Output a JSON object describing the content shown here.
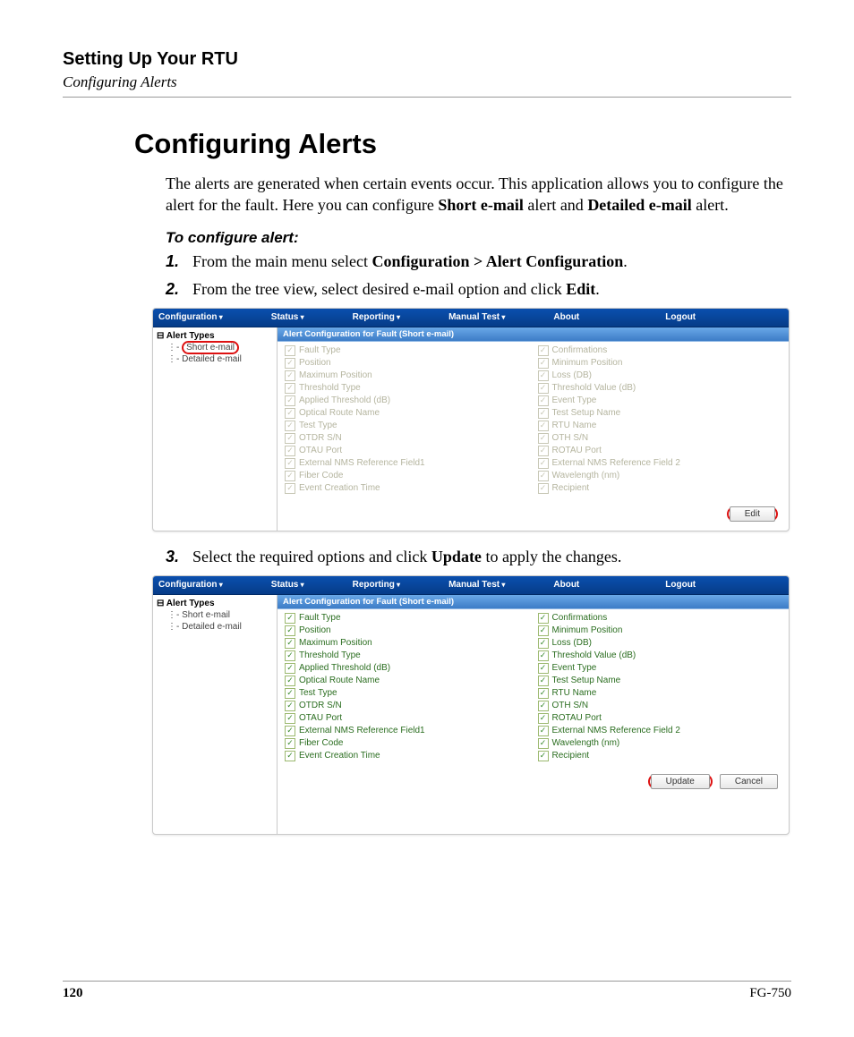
{
  "header": {
    "chapter": "Setting Up Your RTU",
    "section": "Configuring Alerts"
  },
  "heading": "Configuring Alerts",
  "intro": {
    "p1a": "The alerts are generated when certain events occur. This application allows you to configure the alert for the fault. Here you can configure ",
    "short": "Short e-mail",
    "p1b": " alert and ",
    "detailed": "Detailed e-mail",
    "p1c": " alert."
  },
  "proc_heading": "To configure alert:",
  "steps": {
    "s1": {
      "n": "1.",
      "a": "From the main menu select ",
      "b": "Configuration > Alert Configuration",
      "c": "."
    },
    "s2": {
      "n": "2.",
      "a": "From the tree view, select desired e-mail option and click ",
      "b": "Edit",
      "c": "."
    },
    "s3": {
      "n": "3.",
      "a": "Select the required options and click ",
      "b": "Update",
      "c": " to apply the changes."
    }
  },
  "menubar": {
    "configuration": "Configuration",
    "status": "Status",
    "reporting": "Reporting",
    "manual_test": "Manual Test",
    "about": "About",
    "logout": "Logout"
  },
  "tree": {
    "root": "Alert Types",
    "short": "Short e-mail",
    "detailed": "Detailed e-mail"
  },
  "panel_title": "Alert Configuration for Fault (Short e-mail)",
  "fields": {
    "fault_type": "Fault Type",
    "confirmations": "Confirmations",
    "position": "Position",
    "min_position": "Minimum Position",
    "max_position": "Maximum Position",
    "loss_db": "Loss (DB)",
    "threshold_type": "Threshold Type",
    "threshold_value": "Threshold Value (dB)",
    "applied_threshold": "Applied Threshold (dB)",
    "event_type": "Event Type",
    "optical_route": "Optical Route Name",
    "test_setup": "Test Setup Name",
    "test_type": "Test Type",
    "rtu_name": "RTU Name",
    "otdr_sn": "OTDR S/N",
    "oth_sn": "OTH S/N",
    "otau_port": "OTAU Port",
    "rotau_port": "ROTAU Port",
    "ext_nms1": "External NMS Reference Field1",
    "ext_nms2": "External NMS Reference Field 2",
    "fiber_code": "Fiber Code",
    "wavelength": "Wavelength (nm)",
    "event_creation": "Event Creation Time",
    "recipient": "Recipient"
  },
  "buttons": {
    "edit": "Edit",
    "update": "Update",
    "cancel": "Cancel"
  },
  "footer": {
    "page": "120",
    "doc": "FG-750"
  }
}
